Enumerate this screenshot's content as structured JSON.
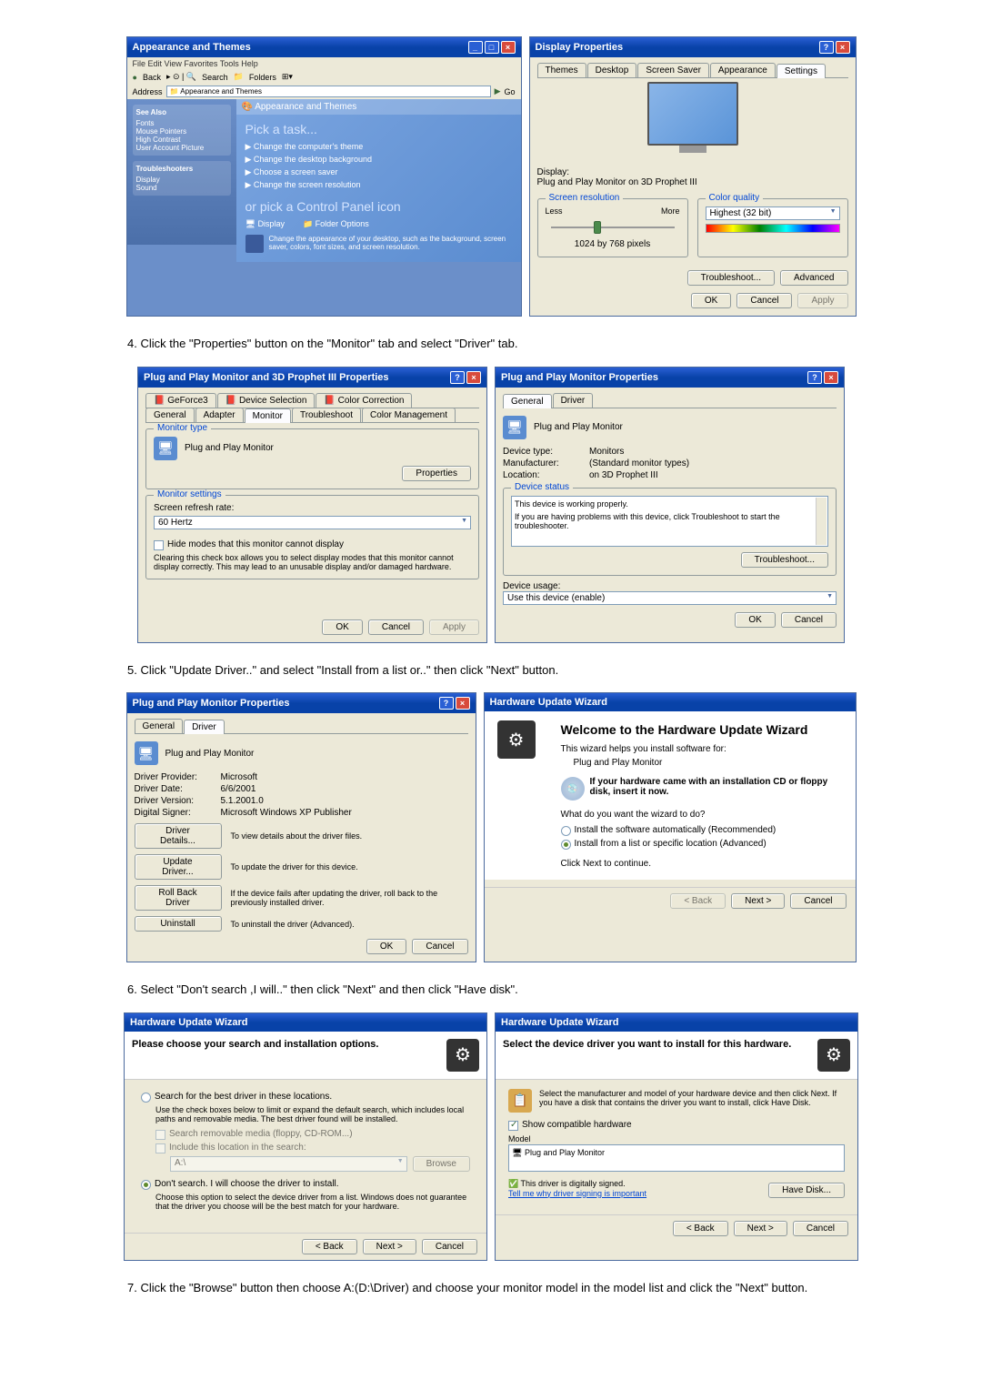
{
  "steps": {
    "step4": "4.   Click the \"Properties\" button on the \"Monitor\" tab and select \"Driver\" tab.",
    "step5": "5.   Click \"Update Driver..\" and select \"Install from a list or..\" then click \"Next\" button.",
    "step6": "6.   Select \"Don't search ,I will..\" then click \"Next\" and then click \"Have disk\".",
    "step7": "7.   Click the \"Browse\" button then choose A:(D:\\Driver) and choose your monitor model in the model list and click the \"Next\" button."
  },
  "controlPanel": {
    "title": "Appearance and Themes",
    "menubar": "File   Edit   View   Favorites   Tools   Help",
    "back": "Back",
    "search": "Search",
    "folders": "Folders",
    "addressLabel": "Address",
    "addressValue": "Appearance and Themes",
    "go": "Go",
    "seeAlso": "See Also",
    "seeAlsoItems": [
      "Fonts",
      "Mouse Pointers",
      "High Contrast",
      "User Account Picture"
    ],
    "troubleshooters": "Troubleshooters",
    "troubleItems": [
      "Display",
      "Sound"
    ],
    "bannerTitle": "Appearance and Themes",
    "pickTask": "Pick a task...",
    "tasks": [
      "Change the computer's theme",
      "Change the desktop background",
      "Choose a screen saver",
      "Change the screen resolution"
    ],
    "orPick": "or pick a Control Panel icon",
    "icons": [
      "Display",
      "Folder Options"
    ],
    "iconDesc": "Change the appearance of your desktop, such as the background, screen saver, colors, font sizes, and screen resolution."
  },
  "displayProps": {
    "title": "Display Properties",
    "tabs": [
      "Themes",
      "Desktop",
      "Screen Saver",
      "Appearance",
      "Settings"
    ],
    "displayLabel": "Display:",
    "displayValue": "Plug and Play Monitor on 3D Prophet III",
    "resGroup": "Screen resolution",
    "less": "Less",
    "more": "More",
    "resValue": "1024 by 768 pixels",
    "colorGroup": "Color quality",
    "colorValue": "Highest (32 bit)",
    "troubleshoot": "Troubleshoot...",
    "advanced": "Advanced",
    "ok": "OK",
    "cancel": "Cancel",
    "apply": "Apply"
  },
  "advProps": {
    "title": "Plug and Play Monitor and 3D Prophet III Properties",
    "tabs1": [
      "GeForce3",
      "Device Selection",
      "Color Correction"
    ],
    "tabs2": [
      "General",
      "Adapter",
      "Monitor",
      "Troubleshoot",
      "Color Management"
    ],
    "monTypeGroup": "Monitor type",
    "monTypeValue": "Plug and Play Monitor",
    "propertiesBtn": "Properties",
    "monSettingsGroup": "Monitor settings",
    "refreshLabel": "Screen refresh rate:",
    "refreshValue": "60 Hertz",
    "hideModes": "Hide modes that this monitor cannot display",
    "hideModesDesc": "Clearing this check box allows you to select display modes that this monitor cannot display correctly. This may lead to an unusable display and/or damaged hardware.",
    "ok": "OK",
    "cancel": "Cancel",
    "apply": "Apply"
  },
  "monPropsGeneral": {
    "title": "Plug and Play Monitor Properties",
    "tabs": [
      "General",
      "Driver"
    ],
    "name": "Plug and Play Monitor",
    "devTypeLabel": "Device type:",
    "devTypeValue": "Monitors",
    "mfrLabel": "Manufacturer:",
    "mfrValue": "(Standard monitor types)",
    "locLabel": "Location:",
    "locValue": "on 3D Prophet III",
    "statusGroup": "Device status",
    "statusText": "This device is working properly.",
    "statusHelp": "If you are having problems with this device, click Troubleshoot to start the troubleshooter.",
    "troubleshoot": "Troubleshoot...",
    "usageLabel": "Device usage:",
    "usageValue": "Use this device (enable)",
    "ok": "OK",
    "cancel": "Cancel"
  },
  "monPropsDriver": {
    "title": "Plug and Play Monitor Properties",
    "tabs": [
      "General",
      "Driver"
    ],
    "name": "Plug and Play Monitor",
    "providerLabel": "Driver Provider:",
    "providerValue": "Microsoft",
    "dateLabel": "Driver Date:",
    "dateValue": "6/6/2001",
    "versionLabel": "Driver Version:",
    "versionValue": "5.1.2001.0",
    "signerLabel": "Digital Signer:",
    "signerValue": "Microsoft Windows XP Publisher",
    "detailsBtn": "Driver Details...",
    "detailsDesc": "To view details about the driver files.",
    "updateBtn": "Update Driver...",
    "updateDesc": "To update the driver for this device.",
    "rollbackBtn": "Roll Back Driver",
    "rollbackDesc": "If the device fails after updating the driver, roll back to the previously installed driver.",
    "uninstallBtn": "Uninstall",
    "uninstallDesc": "To uninstall the driver (Advanced).",
    "ok": "OK",
    "cancel": "Cancel"
  },
  "wizard1": {
    "title": "Hardware Update Wizard",
    "heading": "Welcome to the Hardware Update Wizard",
    "intro": "This wizard helps you install software for:",
    "device": "Plug and Play Monitor",
    "cdHint": "If your hardware came with an installation CD or floppy disk, insert it now.",
    "question": "What do you want the wizard to do?",
    "opt1": "Install the software automatically (Recommended)",
    "opt2": "Install from a list or specific location (Advanced)",
    "continue": "Click Next to continue.",
    "back": "< Back",
    "next": "Next >",
    "cancel": "Cancel"
  },
  "wizard2": {
    "title": "Hardware Update Wizard",
    "heading": "Please choose your search and installation options.",
    "opt1": "Search for the best driver in these locations.",
    "opt1desc": "Use the check boxes below to limit or expand the default search, which includes local paths and removable media. The best driver found will be installed.",
    "chk1": "Search removable media (floppy, CD-ROM...)",
    "chk2": "Include this location in the search:",
    "pathValue": "A:\\",
    "browse": "Browse",
    "opt2": "Don't search. I will choose the driver to install.",
    "opt2desc": "Choose this option to select the device driver from a list. Windows does not guarantee that the driver you choose will be the best match for your hardware.",
    "back": "< Back",
    "next": "Next >",
    "cancel": "Cancel"
  },
  "wizard3": {
    "title": "Hardware Update Wizard",
    "heading": "Select the device driver you want to install for this hardware.",
    "hint": "Select the manufacturer and model of your hardware device and then click Next. If you have a disk that contains the driver you want to install, click Have Disk.",
    "showCompat": "Show compatible hardware",
    "modelLabel": "Model",
    "modelItem": "Plug and Play Monitor",
    "signed": "This driver is digitally signed.",
    "tellMe": "Tell me why driver signing is important",
    "haveDisk": "Have Disk...",
    "back": "< Back",
    "next": "Next >",
    "cancel": "Cancel"
  }
}
